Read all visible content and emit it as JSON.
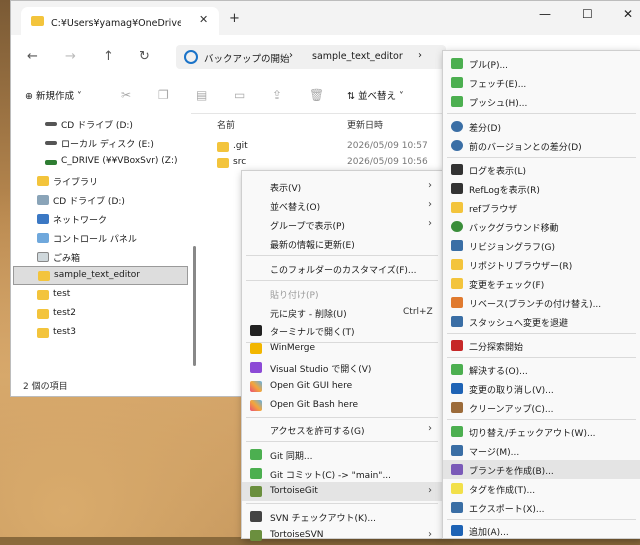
{
  "window": {
    "tab_title": "C:¥Users¥yamag¥OneDrive¥デ",
    "tab_close": "✕",
    "new_tab": "+",
    "minimize": "—",
    "maximize": "☐",
    "close": "✕"
  },
  "address": {
    "root": "バックアップの開始",
    "folder": "sample_text_editor"
  },
  "toolbar": {
    "new_label": "新規作成",
    "sort_label": "並べ替え"
  },
  "nav": {
    "items": [
      {
        "label": "CD ドライブ (D:)",
        "icon": "drive-icon"
      },
      {
        "label": "ローカル ディスク (E:)",
        "icon": "drive-icon"
      },
      {
        "label": "C_DRIVE (¥¥VBoxSvr) (Z:)",
        "icon": "network-drive-icon"
      },
      {
        "label": "ライブラリ",
        "icon": "folder-icon"
      },
      {
        "label": "CD ドライブ (D:)",
        "icon": "cd-icon"
      },
      {
        "label": "ネットワーク",
        "icon": "network-icon"
      },
      {
        "label": "コントロール パネル",
        "icon": "control-panel-icon"
      },
      {
        "label": "ごみ箱",
        "icon": "recycle-bin-icon"
      },
      {
        "label": "sample_text_editor",
        "icon": "git-folder-icon"
      },
      {
        "label": "test",
        "icon": "folder-icon"
      },
      {
        "label": "test2",
        "icon": "folder-icon"
      },
      {
        "label": "test3",
        "icon": "folder-icon"
      }
    ]
  },
  "content": {
    "col_name": "名前",
    "col_date": "更新日時",
    "rows": [
      {
        "name": ".git",
        "date": "2026/05/09 10:57"
      },
      {
        "name": "src",
        "date": "2026/05/09 10:56"
      }
    ]
  },
  "status": "2 個の項目",
  "menu1": {
    "items": [
      {
        "label": "表示(V)",
        "arrow": "›"
      },
      {
        "label": "並べ替え(O)",
        "arrow": "›"
      },
      {
        "label": "グループで表示(P)",
        "arrow": "›"
      },
      {
        "label": "最新の情報に更新(E)"
      },
      {
        "label": "このフォルダーのカスタマイズ(F)..."
      },
      {
        "label": "貼り付け(P)"
      },
      {
        "label": "元に戻す - 削除(U)",
        "shortcut": "Ctrl+Z"
      },
      {
        "label": "ターミナルで開く(T)"
      },
      {
        "label": "WinMerge"
      },
      {
        "label": "Visual Studio で開く(V)"
      },
      {
        "label": "Open Git GUI here"
      },
      {
        "label": "Open Git Bash here"
      },
      {
        "label": "アクセスを許可する(G)",
        "arrow": "›"
      },
      {
        "label": "Git 同期..."
      },
      {
        "label": "Git コミット(C) -> \"main\"..."
      },
      {
        "label": "TortoiseGit",
        "arrow": "›"
      },
      {
        "label": "SVN チェックアウト(K)..."
      },
      {
        "label": "TortoiseSVN",
        "arrow": "›"
      }
    ]
  },
  "menu2": {
    "items": [
      {
        "label": "プル(P)..."
      },
      {
        "label": "フェッチ(E)..."
      },
      {
        "label": "プッシュ(H)..."
      },
      {
        "label": "差分(D)"
      },
      {
        "label": "前のバージョンとの差分(D)"
      },
      {
        "label": "ログを表示(L)"
      },
      {
        "label": "RefLogを表示(R)"
      },
      {
        "label": "refブラウザ"
      },
      {
        "label": "バックグラウンド移動"
      },
      {
        "label": "リビジョングラフ(G)"
      },
      {
        "label": "リポジトリブラウザー(R)"
      },
      {
        "label": "変更をチェック(F)"
      },
      {
        "label": "リベース(ブランチの付け替え)..."
      },
      {
        "label": "スタッシュへ変更を退避"
      },
      {
        "label": "二分探索開始"
      },
      {
        "label": "解決する(O)..."
      },
      {
        "label": "変更の取り消し(V)..."
      },
      {
        "label": "クリーンアップ(C)..."
      },
      {
        "label": "切り替え/チェックアウト(W)..."
      },
      {
        "label": "マージ(M)..."
      },
      {
        "label": "ブランチを作成(B)..."
      },
      {
        "label": "タグを作成(T)..."
      },
      {
        "label": "エクスポート(X)..."
      },
      {
        "label": "追加(A)..."
      }
    ]
  }
}
